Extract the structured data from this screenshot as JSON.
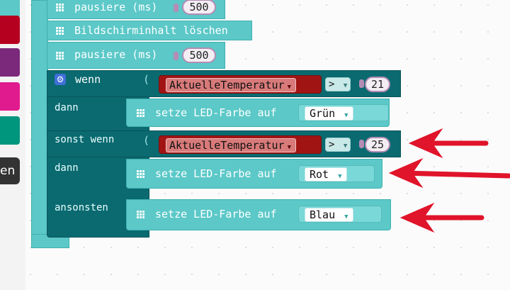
{
  "toolbox": {
    "category_colors": [
      "#5cc8c8",
      "#b5001f",
      "#7b2a7b",
      "#e01b8e",
      "#00967d"
    ],
    "partial_category_label": "en"
  },
  "blocks": {
    "pause1": {
      "label": "pausiere (ms)",
      "value": "500"
    },
    "clear": {
      "label": "Bildschirminhalt löschen"
    },
    "pause2": {
      "label": "pausiere (ms)",
      "value": "500"
    },
    "if_block": {
      "if_label": "wenn",
      "then_label": "dann",
      "elseif_label": "sonst wenn",
      "then2_label": "dann",
      "else_label": "ansonsten",
      "paren": "(",
      "cond1": {
        "variable": "AktuelleTemperatur",
        "operator": ">",
        "value": "21"
      },
      "cond2": {
        "variable": "AktuelleTemperatur",
        "operator": ">",
        "value": "25"
      },
      "set1": {
        "label": "setze LED-Farbe auf",
        "color": "Grün"
      },
      "set2": {
        "label": "setze LED-Farbe auf",
        "color": "Rot"
      },
      "set3": {
        "label": "setze LED-Farbe auf",
        "color": "Blau"
      }
    }
  },
  "colors": {
    "led_block": "#5cc8c8",
    "logic_block": "#0a6a70",
    "variable_block": "#a11414",
    "number_border": "#b58cb5",
    "annotation_arrow": "#e0142a"
  },
  "icons": {
    "grid": "grid-icon",
    "gear": "gear-icon",
    "dropdown": "dropdown-triangle-icon",
    "arrow": "red-arrow-icon"
  }
}
